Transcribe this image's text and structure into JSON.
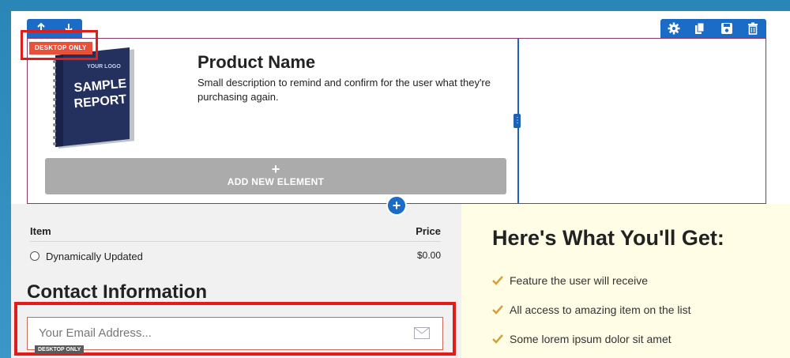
{
  "toolbar": {
    "move_up_icon": "arrow-up-icon",
    "move_down_icon": "arrow-down-icon",
    "row_icons": [
      "gear-icon",
      "copy-icon",
      "save-icon",
      "trash-icon"
    ],
    "desktop_only_badge": "DESKTOP ONLY"
  },
  "product": {
    "image_icon": "sample-report-book",
    "book_logo": "YOUR LOGO",
    "book_title_1": "SAMPLE",
    "book_title_2": "REPORT",
    "name": "Product Name",
    "description": "Small description to remind and confirm for the user what they're purchasing again."
  },
  "builder": {
    "add_plus": "+",
    "add_element_label": "ADD NEW ELEMENT",
    "add_row_plus": "+"
  },
  "order_table": {
    "headers": {
      "item": "Item",
      "price": "Price"
    },
    "rows": [
      {
        "item": "Dynamically Updated",
        "price": "$0.00"
      }
    ]
  },
  "contact": {
    "title": "Contact Information",
    "email_placeholder": "Your Email Address...",
    "desktop_only_badge": "DESKTOP ONLY"
  },
  "benefits": {
    "title": "Here's What You'll Get:",
    "features": [
      "Feature the user will receive",
      "All access to amazing item on the list",
      "Some lorem ipsum dolor sit amet"
    ]
  },
  "colors": {
    "accent_blue": "#1a6cc7",
    "highlight_red": "#e21b1b",
    "badge_orange": "#e8503a",
    "check_gold": "#d4a13a",
    "benefits_bg": "#fffde6"
  }
}
